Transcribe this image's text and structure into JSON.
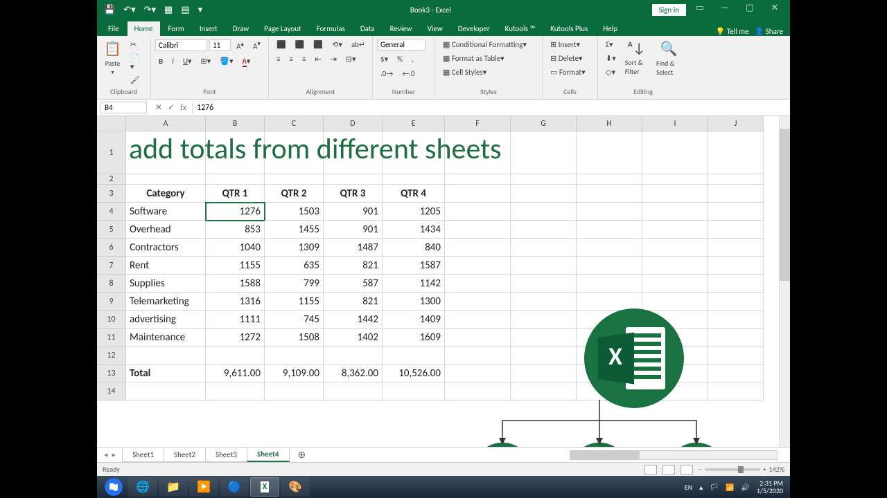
{
  "app": {
    "title": "Book3 - Excel"
  },
  "titlebar": {
    "signin": "Sign in"
  },
  "tabs": {
    "list": [
      "File",
      "Home",
      "Form",
      "Insert",
      "Draw",
      "Page Layout",
      "Formulas",
      "Data",
      "Review",
      "View",
      "Developer",
      "Kutools ™",
      "Kutools Plus",
      "Help"
    ],
    "active": "Home",
    "tellme": "Tell me",
    "share": "Share"
  },
  "ribbon": {
    "clipboard": {
      "label": "Clipboard",
      "paste": "Paste"
    },
    "font": {
      "label": "Font",
      "name": "Calibri",
      "size": "11"
    },
    "alignment": {
      "label": "Alignment"
    },
    "number": {
      "label": "Number",
      "format": "General"
    },
    "styles": {
      "label": "Styles",
      "cf": "Conditional Formatting",
      "ft": "Format as Table",
      "cs": "Cell Styles"
    },
    "cells": {
      "label": "Cells",
      "insert": "Insert",
      "delete": "Delete",
      "format": "Format"
    },
    "editing": {
      "label": "Editing",
      "sort": "Sort & Filter",
      "find": "Find & Select"
    }
  },
  "formula": {
    "cell": "B4",
    "fx": "fx",
    "value": "1276"
  },
  "columns": [
    "A",
    "B",
    "C",
    "D",
    "E",
    "F",
    "G",
    "H",
    "I",
    "J"
  ],
  "rows": [
    "1",
    "2",
    "3",
    "4",
    "5",
    "6",
    "7",
    "8",
    "9",
    "10",
    "11",
    "12",
    "13",
    "14"
  ],
  "overlay": "add totals from different sheets",
  "headers": {
    "cat": "Category",
    "q1": "QTR 1",
    "q2": "QTR 2",
    "q3": "QTR 3",
    "q4": "QTR 4"
  },
  "data": [
    {
      "cat": "Software",
      "q1": "1276",
      "q2": "1503",
      "q3": "901",
      "q4": "1205"
    },
    {
      "cat": "Overhead",
      "q1": "853",
      "q2": "1455",
      "q3": "901",
      "q4": "1434"
    },
    {
      "cat": "Contractors",
      "q1": "1040",
      "q2": "1309",
      "q3": "1487",
      "q4": "840"
    },
    {
      "cat": "Rent",
      "q1": "1155",
      "q2": "635",
      "q3": "821",
      "q4": "1587"
    },
    {
      "cat": "Supplies",
      "q1": "1588",
      "q2": "799",
      "q3": "587",
      "q4": "1142"
    },
    {
      "cat": "Telemarketing",
      "q1": "1316",
      "q2": "1155",
      "q3": "821",
      "q4": "1300"
    },
    {
      "cat": "advertising",
      "q1": "1111",
      "q2": "745",
      "q3": "1442",
      "q4": "1409"
    },
    {
      "cat": "Maintenance",
      "q1": "1272",
      "q2": "1508",
      "q3": "1402",
      "q4": "1609"
    }
  ],
  "totals": {
    "label": "Total",
    "q1": "9,611.00",
    "q2": "9,109.00",
    "q3": "8,362.00",
    "q4": "10,526.00"
  },
  "sheets": {
    "list": [
      "Sheet1",
      "Sheet2",
      "Sheet3",
      "Sheet4"
    ],
    "active": "Sheet4"
  },
  "status": {
    "ready": "Ready",
    "zoom": "142%"
  },
  "tray": {
    "lang": "EN",
    "time": "2:31 PM",
    "date": "1/5/2020"
  }
}
